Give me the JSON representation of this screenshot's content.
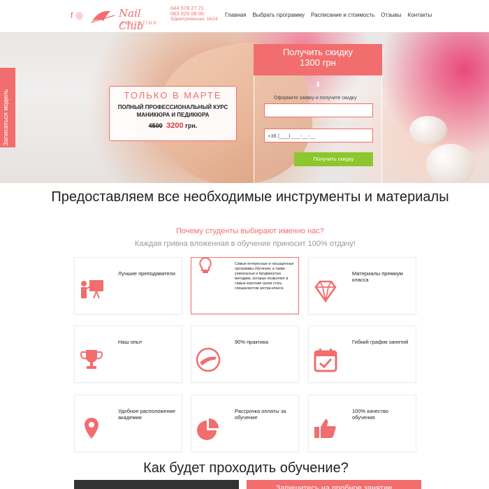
{
  "header": {
    "social": [
      "facebook-icon",
      "instagram-icon"
    ],
    "logo_text": "Nail Club",
    "logo_sub": "education",
    "phone1": "044 578 27 71",
    "phone2": "063 029 08 00",
    "address": "Дмитриевская, 16/24",
    "nav": [
      "Главная",
      "Выбрать программу",
      "Расписание и стоимость",
      "Отзывы",
      "Контакты"
    ]
  },
  "side_tab": "Записаться модель",
  "promo": {
    "title": "ТОЛЬКО В МАРТЕ",
    "line1": "ПОЛНЫЙ ПРОФЕССИОНАЛЬНЫЙ КУРС",
    "line2": "МАНИКЮРА И ПЕДИКЮРА",
    "old_price": "4500",
    "new_price": "3200",
    "currency": "грн."
  },
  "form": {
    "head1": "Получить скидку",
    "head2": "1300 грн",
    "hint": "Оформите заявку и получите скидку",
    "name_placeholder": "",
    "phone_placeholder": "+38 (___) ___-__-__",
    "submit": "Получить скидку"
  },
  "section": {
    "title": "Предоставляем все необходимые инструменты и материалы",
    "subtitle": "Почему студенты выбирают именно нас?",
    "subtitle2": "Каждая гривна вложенная в обучение приносит 100% отдачу!"
  },
  "cards": [
    {
      "label": "Лучшие преподаватели",
      "icon": "teacher-icon"
    },
    {
      "label": "Самые интересные и насыщенные программы обучения, а также уникальные и продвинутые методики, которые позволяют в самые короткие сроки стать специалистом экстра-класса",
      "icon": "lightbulb-icon"
    },
    {
      "label": "Материалы премиум класса",
      "icon": "diamond-icon"
    },
    {
      "label": "Наш опыт",
      "icon": "trophy-icon"
    },
    {
      "label": "90% практика",
      "icon": "manicure-icon"
    },
    {
      "label": "Гибкий график занятий",
      "icon": "calendar-icon"
    },
    {
      "label": "Удобное расположение академии",
      "icon": "location-pin-icon"
    },
    {
      "label": "Рассрочка оплаты за обучение",
      "icon": "pie-chart-icon"
    },
    {
      "label": "100% качество обучения",
      "icon": "thumbs-up-icon"
    }
  ],
  "bottom": {
    "title": "Как будет проходить обучение?",
    "trial_button": "Запишитесь на пробное занятие"
  },
  "colors": {
    "accent": "#f26d6d",
    "green": "#8cc72e"
  }
}
